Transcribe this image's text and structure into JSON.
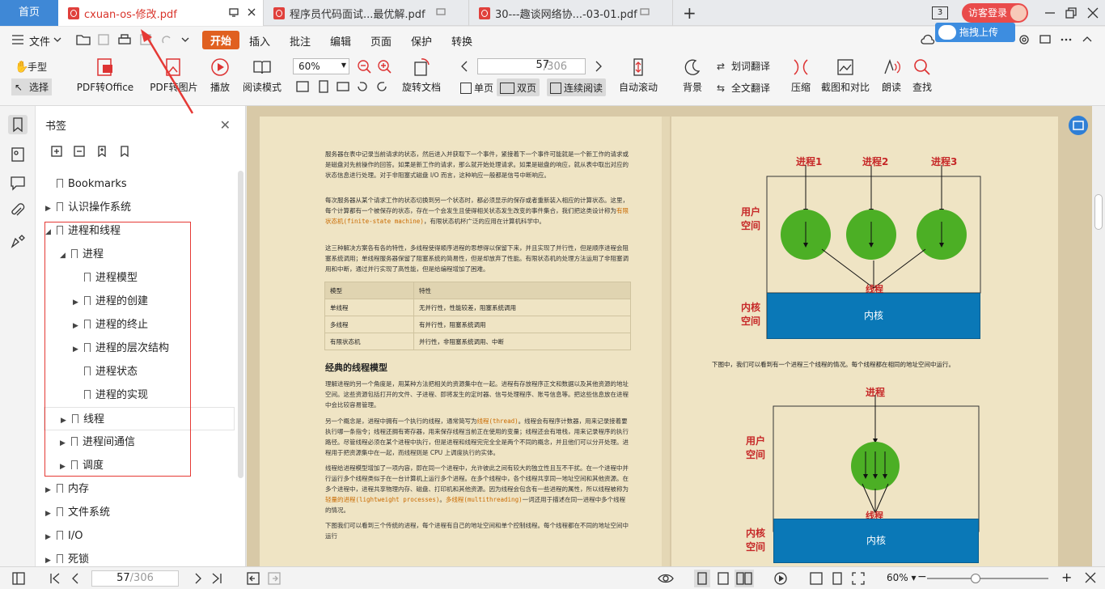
{
  "tabs": {
    "home": "首页",
    "documents": [
      {
        "title": "cxuan-os-修改.pdf",
        "active": true
      },
      {
        "title": "程序员代码面试...最优解.pdf",
        "active": false
      },
      {
        "title": "30---趣谈网络协...-03-01.pdf",
        "active": false
      }
    ],
    "new_tab": "+",
    "tab_count": "3",
    "visitor_login": "访客登录",
    "upload": "拖拽上传"
  },
  "menu": {
    "file": "文件",
    "items": [
      "开始",
      "插入",
      "批注",
      "编辑",
      "页面",
      "保护",
      "转换"
    ],
    "active": "开始"
  },
  "ribbon": {
    "hand": "手型",
    "select": "选择",
    "pdf_to_office": "PDF转Office",
    "pdf_to_image": "PDF转图片",
    "play": "播放",
    "read_mode": "阅读模式",
    "zoom": "60%",
    "rotate": "旋转文档",
    "page_current": "57",
    "page_total": "/306",
    "single": "单页",
    "double": "双页",
    "continuous": "连续阅读",
    "auto_scroll": "自动滚动",
    "background": "背景",
    "word_translate": "划词翻译",
    "full_translate": "全文翻译",
    "compress": "压缩",
    "screenshot_compare": "截图和对比",
    "read_aloud": "朗读",
    "find": "查找"
  },
  "bookmarks": {
    "title": "书签",
    "items": [
      {
        "label": "Bookmarks",
        "level": 0,
        "arrow": ""
      },
      {
        "label": "认识操作系统",
        "level": 0,
        "arrow": "▶"
      },
      {
        "label": "进程和线程",
        "level": 0,
        "arrow": "◢"
      },
      {
        "label": "进程",
        "level": 1,
        "arrow": "◢"
      },
      {
        "label": "进程模型",
        "level": 2,
        "arrow": ""
      },
      {
        "label": "进程的创建",
        "level": 2,
        "arrow": "▶"
      },
      {
        "label": "进程的终止",
        "level": 2,
        "arrow": "▶"
      },
      {
        "label": "进程的层次结构",
        "level": 2,
        "arrow": "▶"
      },
      {
        "label": "进程状态",
        "level": 2,
        "arrow": ""
      },
      {
        "label": "进程的实现",
        "level": 2,
        "arrow": ""
      },
      {
        "label": "线程",
        "level": 1,
        "arrow": "▶"
      },
      {
        "label": "进程间通信",
        "level": 1,
        "arrow": "▶"
      },
      {
        "label": "调度",
        "level": 1,
        "arrow": "▶"
      },
      {
        "label": "内存",
        "level": 0,
        "arrow": "▶"
      },
      {
        "label": "文件系统",
        "level": 0,
        "arrow": "▶"
      },
      {
        "label": "I/O",
        "level": 0,
        "arrow": "▶"
      },
      {
        "label": "死锁",
        "level": 0,
        "arrow": "▶"
      }
    ]
  },
  "page_left": {
    "p1": "服务器在表中记录当前请求的状态，然后进入并获取下一个事件，紧接着下一个事件可能就是一个新工作的请求或是磁盘对先前操作的回答。如果是新工作的请求，那么就开始处理请求。如果是磁盘的响应，就从表中取出对应的状态信息进行处理。对于非阻塞式磁盘 I/O 而言，这种响应一般都是信号中断响应。",
    "p2a": "每次服务器从某个请求工作的状态切换到另一个状态时，都必须显示的保存或者重新装入相应的计算状态。这里，每个计算都有一个被保存的状态，存在一个会发生且使得相关状态发生改变的事件集合，我们把这类设计称为",
    "p2_hl": "有限状态机(finite-state machine)",
    "p2b": "，有限状态机杯广泛的应用在计算机科学中。",
    "p3": "这三种解决方案各有各的特性，多线程使得顺序进程的思想得以保留下来，并且实现了并行性，但是顺序进程会阻塞系统调用；单线程服务器保留了阻塞系统的简易性，但是却放弃了性能。有限状态机的处理方法运用了非阻塞调用和中断，通过并行实现了高性能，但是给编程增加了困难。",
    "table_headers": [
      "模型",
      "特性"
    ],
    "table_rows": [
      [
        "单线程",
        "无并行性，性能较差，阻塞系统调用"
      ],
      [
        "多线程",
        "有并行性，阻塞系统调用"
      ],
      [
        "有限状态机",
        "并行性，非阻塞系统调用、中断"
      ]
    ],
    "heading": "经典的线程模型",
    "p4": "理解进程的另一个角度是，用某种方法把相关的资源集中在一起。进程有存放程序正文和数据以及其他资源的地址空间。这些资源包括打开的文件、子进程、即将发生的定时器、信号处理程序、账号信息等。把这些信息放在进程中会比较容易管理。",
    "p5a": "另一个概念是，进程中拥有一个执行的线程，通常简写为",
    "p5_hl": "线程(thread)",
    "p5b": "。线程会有程序计数器，用来记录接着要执行哪一条指令；线程还拥有寄存器，用来保存线程当前正在使用的变量；线程还会有堆栈，用来记录程序的执行路径。尽管线程必须在某个进程中执行，但是进程和线程完完全全是两个不同的概念，并且他们可以分开处理。进程用于把资源集中在一起，而线程则是 CPU 上调度执行的实体。",
    "p6a": "线程给进程模型增加了一项内容，即在同一个进程中，允许彼此之间有较大的独立性且互不干扰。在一个进程中并行运行多个线程类似于在一台计算机上运行多个进程。在多个线程中，各个线程共享同一地址空间和其他资源。在多个进程中，进程共享物理内存、磁盘、打印机和其他资源。因为线程会包含有一些进程的属性，所以线程被称为",
    "p6_hl1": "轻量的进程(lightweight processes)",
    "p6_mid": "。",
    "p6_hl2": "多线程(multithreading)",
    "p6b": "一词还用于描述在同一进程中多个线程的情况。",
    "p7": "下图我们可以看到三个传统的进程，每个进程有自己的地址空间和单个控制线程。每个线程都在不同的地址空间中运行"
  },
  "page_right": {
    "diagram1": {
      "processes": [
        "进程1",
        "进程2",
        "进程3"
      ],
      "user_space": "用户空间",
      "thread": "线程",
      "kernel_label": "内核空间",
      "kernel": "内核"
    },
    "caption": "下图中，我们可以看到有一个进程三个线程的情况。每个线程都在相同的地址空间中运行。",
    "diagram2": {
      "process": "进程",
      "user_space": "用户空间",
      "thread": "线程",
      "kernel_label": "内核空间",
      "kernel": "内核"
    }
  },
  "status": {
    "page_current": "57",
    "page_total": "/306",
    "zoom": "60%"
  },
  "colors": {
    "accent": "#e06020",
    "home_tab": "#3f88d6",
    "highlight_box": "#e53935",
    "kernel": "#0a78b7",
    "thread_circle": "#4caf25"
  }
}
